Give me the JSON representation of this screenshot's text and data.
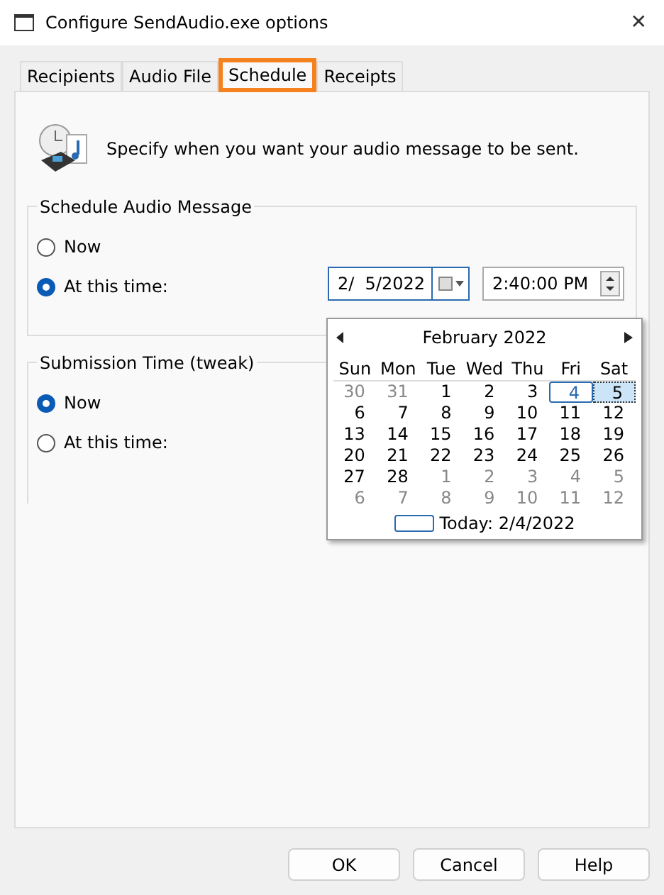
{
  "window": {
    "title": "Configure SendAudio.exe options",
    "close": "✕"
  },
  "tabs": [
    {
      "label": "Recipients",
      "selected": false,
      "highlighted": false
    },
    {
      "label": "Audio File",
      "selected": false,
      "highlighted": false
    },
    {
      "label": "Schedule",
      "selected": true,
      "highlighted": true
    },
    {
      "label": "Receipts",
      "selected": false,
      "highlighted": false
    }
  ],
  "intro": "Specify when you want your audio message to be sent.",
  "schedule_group": {
    "title": "Schedule Audio Message",
    "options": [
      {
        "label": "Now",
        "selected": false
      },
      {
        "label": "At this time:",
        "selected": true
      }
    ],
    "date": "2/  5/2022",
    "time": "2:40:00 PM"
  },
  "submission_group": {
    "title": "Submission Time (tweak)",
    "options": [
      {
        "label": "Now",
        "selected": true
      },
      {
        "label": "At this time:",
        "selected": false
      }
    ]
  },
  "calendar": {
    "month": "February 2022",
    "weekdays": [
      "Sun",
      "Mon",
      "Tue",
      "Wed",
      "Thu",
      "Fri",
      "Sat"
    ],
    "days": [
      {
        "d": "30",
        "muted": true,
        "today": false,
        "selected": false
      },
      {
        "d": "31",
        "muted": true,
        "today": false,
        "selected": false
      },
      {
        "d": "1",
        "muted": false,
        "today": false,
        "selected": false
      },
      {
        "d": "2",
        "muted": false,
        "today": false,
        "selected": false
      },
      {
        "d": "3",
        "muted": false,
        "today": false,
        "selected": false
      },
      {
        "d": "4",
        "muted": false,
        "today": true,
        "selected": false
      },
      {
        "d": "5",
        "muted": false,
        "today": false,
        "selected": true
      },
      {
        "d": "6",
        "muted": false,
        "today": false,
        "selected": false
      },
      {
        "d": "7",
        "muted": false,
        "today": false,
        "selected": false
      },
      {
        "d": "8",
        "muted": false,
        "today": false,
        "selected": false
      },
      {
        "d": "9",
        "muted": false,
        "today": false,
        "selected": false
      },
      {
        "d": "10",
        "muted": false,
        "today": false,
        "selected": false
      },
      {
        "d": "11",
        "muted": false,
        "today": false,
        "selected": false
      },
      {
        "d": "12",
        "muted": false,
        "today": false,
        "selected": false
      },
      {
        "d": "13",
        "muted": false,
        "today": false,
        "selected": false
      },
      {
        "d": "14",
        "muted": false,
        "today": false,
        "selected": false
      },
      {
        "d": "15",
        "muted": false,
        "today": false,
        "selected": false
      },
      {
        "d": "16",
        "muted": false,
        "today": false,
        "selected": false
      },
      {
        "d": "17",
        "muted": false,
        "today": false,
        "selected": false
      },
      {
        "d": "18",
        "muted": false,
        "today": false,
        "selected": false
      },
      {
        "d": "19",
        "muted": false,
        "today": false,
        "selected": false
      },
      {
        "d": "20",
        "muted": false,
        "today": false,
        "selected": false
      },
      {
        "d": "21",
        "muted": false,
        "today": false,
        "selected": false
      },
      {
        "d": "22",
        "muted": false,
        "today": false,
        "selected": false
      },
      {
        "d": "23",
        "muted": false,
        "today": false,
        "selected": false
      },
      {
        "d": "24",
        "muted": false,
        "today": false,
        "selected": false
      },
      {
        "d": "25",
        "muted": false,
        "today": false,
        "selected": false
      },
      {
        "d": "26",
        "muted": false,
        "today": false,
        "selected": false
      },
      {
        "d": "27",
        "muted": false,
        "today": false,
        "selected": false
      },
      {
        "d": "28",
        "muted": false,
        "today": false,
        "selected": false
      },
      {
        "d": "1",
        "muted": true,
        "today": false,
        "selected": false
      },
      {
        "d": "2",
        "muted": true,
        "today": false,
        "selected": false
      },
      {
        "d": "3",
        "muted": true,
        "today": false,
        "selected": false
      },
      {
        "d": "4",
        "muted": true,
        "today": false,
        "selected": false
      },
      {
        "d": "5",
        "muted": true,
        "today": false,
        "selected": false
      },
      {
        "d": "6",
        "muted": true,
        "today": false,
        "selected": false
      },
      {
        "d": "7",
        "muted": true,
        "today": false,
        "selected": false
      },
      {
        "d": "8",
        "muted": true,
        "today": false,
        "selected": false
      },
      {
        "d": "9",
        "muted": true,
        "today": false,
        "selected": false
      },
      {
        "d": "10",
        "muted": true,
        "today": false,
        "selected": false
      },
      {
        "d": "11",
        "muted": true,
        "today": false,
        "selected": false
      },
      {
        "d": "12",
        "muted": true,
        "today": false,
        "selected": false
      }
    ],
    "today": "Today: 2/4/2022"
  },
  "buttons": [
    "OK",
    "Cancel",
    "Help"
  ]
}
